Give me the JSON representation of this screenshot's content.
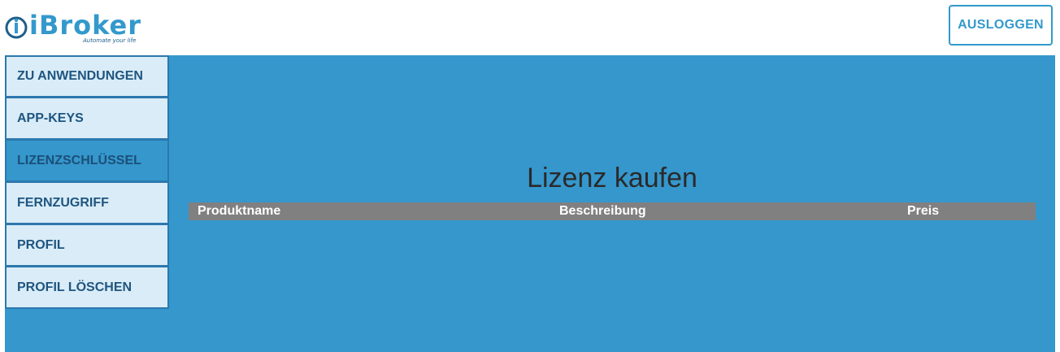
{
  "header": {
    "logo": {
      "text": "iBroker",
      "tagline": "Automate your life"
    },
    "logout_label": "AUSLOGGEN"
  },
  "sidebar": {
    "items": [
      {
        "label": "ZU ANWENDUNGEN",
        "active": false
      },
      {
        "label": "APP-KEYS",
        "active": false
      },
      {
        "label": "LIZENZSCHLÜSSEL",
        "active": true
      },
      {
        "label": "FERNZUGRIFF",
        "active": false
      },
      {
        "label": "PROFIL",
        "active": false
      },
      {
        "label": "PROFIL LÖSCHEN",
        "active": false
      }
    ]
  },
  "main": {
    "title": "Lizenz kaufen",
    "table": {
      "columns": [
        "Produktname",
        "Beschreibung",
        "Preis"
      ],
      "rows": []
    }
  },
  "colors": {
    "brand": "#3399cc",
    "main_background": "#3597cc",
    "sidebar_item": "#d9ecf7",
    "table_header": "#808080"
  }
}
